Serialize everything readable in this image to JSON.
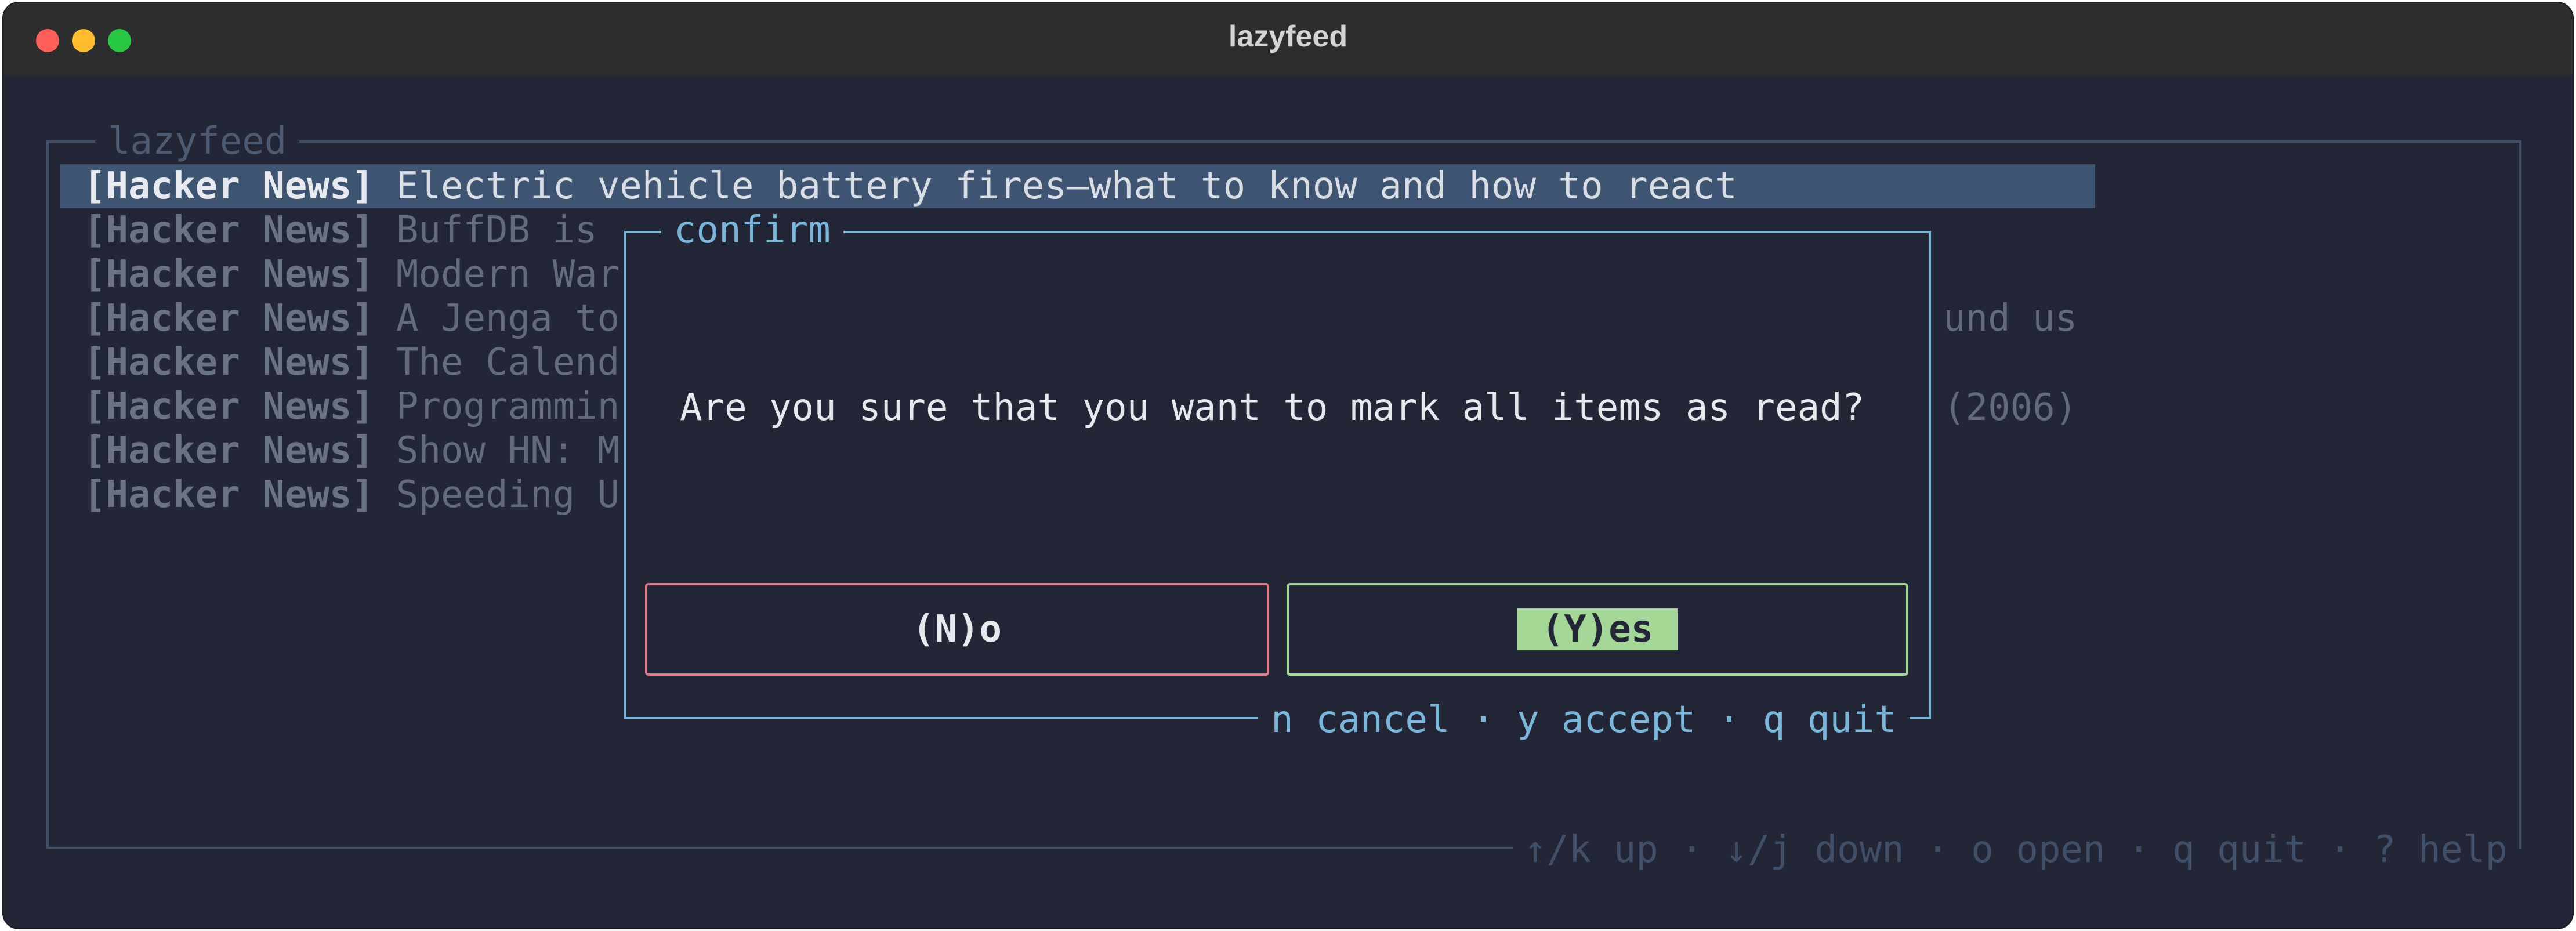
{
  "window": {
    "title": "lazyfeed"
  },
  "panel": {
    "title": "lazyfeed"
  },
  "items": [
    {
      "source": "[Hacker News]",
      "title": "Electric vehicle battery fires—what to know and how to react",
      "selected": true
    },
    {
      "source": "[Hacker News]",
      "title": "BuffDB is"
    },
    {
      "source": "[Hacker News]",
      "title": "Modern War"
    },
    {
      "source": "[Hacker News]",
      "title": "A Jenga to"
    },
    {
      "source": "[Hacker News]",
      "title": "The Calend"
    },
    {
      "source": "[Hacker News]",
      "title": "Programmin"
    },
    {
      "source": "[Hacker News]",
      "title": "Show HN: M"
    },
    {
      "source": "[Hacker News]",
      "title": "Speeding U"
    }
  ],
  "visible_tails": {
    "row4": "und us",
    "row6": "(2006)"
  },
  "help_bar": "↑/k up · ↓/j down · o open · q quit · ? help",
  "dialog": {
    "title": "confirm",
    "message": "Are you sure that you want to mark all items as read?",
    "no_label": "(N)o",
    "yes_label": "(Y)es",
    "help": "n cancel · y accept · q quit"
  },
  "colors": {
    "background": "#232637",
    "selected_row": "#3d5573",
    "dialog_border": "#79b8dc",
    "no_border": "#e07a86",
    "yes_accent": "#a3d795"
  }
}
